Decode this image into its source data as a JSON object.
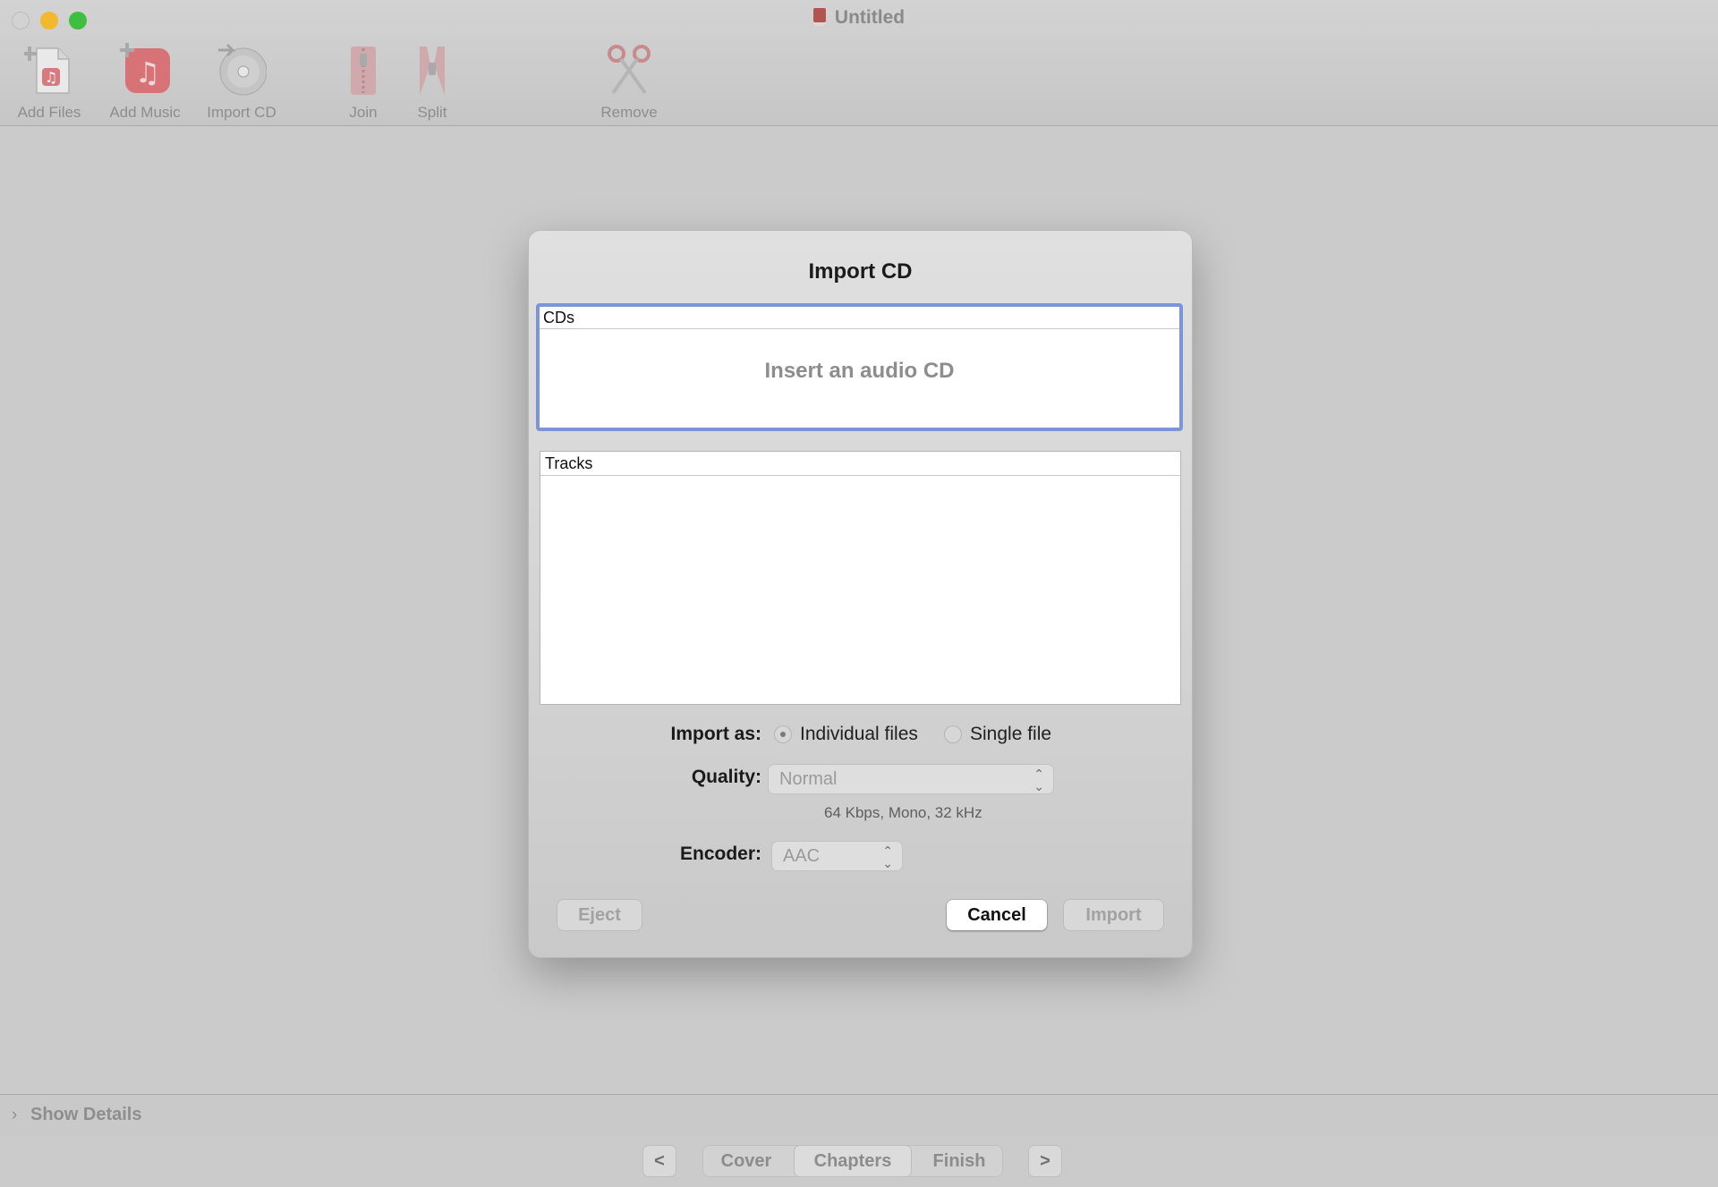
{
  "window": {
    "title": "Untitled"
  },
  "toolbar": {
    "add_files": "Add Files",
    "add_music": "Add Music",
    "import_cd": "Import CD",
    "join": "Join",
    "split": "Split",
    "remove": "Remove"
  },
  "dialog": {
    "title": "Import CD",
    "cds_header": "CDs",
    "cds_placeholder": "Insert an audio CD",
    "tracks_header": "Tracks",
    "import_as_label": "Import as:",
    "import_as_options": [
      "Individual files",
      "Single file"
    ],
    "import_as_selected": "Individual files",
    "quality_label": "Quality:",
    "quality_value": "Normal",
    "quality_hint": "64 Kbps, Mono, 32 kHz",
    "encoder_label": "Encoder:",
    "encoder_value": "AAC",
    "eject_label": "Eject",
    "cancel_label": "Cancel",
    "import_label": "Import"
  },
  "details": {
    "label": "Show Details"
  },
  "nav": {
    "prev": "<",
    "next": ">",
    "steps": [
      "Cover",
      "Chapters",
      "Finish"
    ],
    "active_step": "Chapters"
  },
  "colors": {
    "focus_ring": "#7b95d6",
    "close": "#d2d2d2",
    "minimize": "#f2b92e",
    "zoom": "#3fbf3f"
  }
}
